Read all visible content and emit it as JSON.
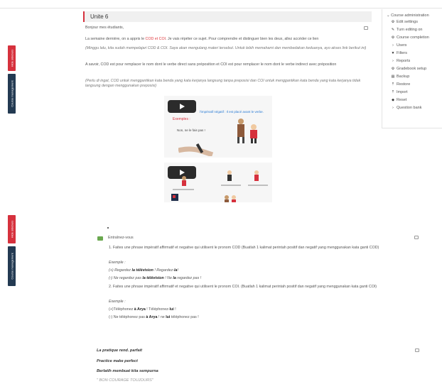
{
  "sidetabs": {
    "hide_sidebars": "Hide sidebars",
    "course_management": "Course management"
  },
  "section": {
    "title": "Unite 6",
    "greeting": "Bonjour mes étudiants,",
    "intro_a": "La semaine dernière, on a appris le ",
    "intro_cod": "COD et COI",
    "intro_b": ". Je vais répéter ce sujet. Pour comprendre et distinguer bien les deux, allez accéder ce lien",
    "intro_id": "(Minggu lalu, kita sudah mempelajari COD & COI. Saya akan mengulang materi tersebut. Untuk lebih memahami dan membedakan keduanya, ayo akses link berikut ini)",
    "def_fr": "A savoir, COD est pour remplacer le nom dont le verbe direct sans préposition et COI est pour remplacer le nom dont le verbe indirect avec préposition",
    "def_id": "(Perlu di ingat, COD untuk menggantikan kata benda yang kata kerjanya langsung tanpa preposisi dan COI untuk menggantikan kata benda yang kata kerjanya tidak langsung dengan menggunakan preposisi)"
  },
  "video1": {
    "caption": "l'impératif négatif : Il est placé avant le verbe.",
    "label": "Exemples :",
    "sample": "Non, ne le fais pas !"
  },
  "admin": {
    "title": "Course administration",
    "items": [
      {
        "icon": "gear-icon",
        "glyph": "⚙",
        "label": "Edit settings"
      },
      {
        "icon": "pencil-icon",
        "glyph": "✎",
        "label": "Turn editing on"
      },
      {
        "icon": "gear-icon",
        "glyph": "⚙",
        "label": "Course completion"
      },
      {
        "icon": "chevron-right-icon",
        "glyph": "›",
        "label": "Users"
      },
      {
        "icon": "filter-icon",
        "glyph": "▼",
        "label": "Filters"
      },
      {
        "icon": "chevron-right-icon",
        "glyph": "›",
        "label": "Reports"
      },
      {
        "icon": "gear-icon",
        "glyph": "⚙",
        "label": "Gradebook setup"
      },
      {
        "icon": "backup-icon",
        "glyph": "▤",
        "label": "Backup"
      },
      {
        "icon": "restore-icon",
        "glyph": "⤒",
        "label": "Restore"
      },
      {
        "icon": "import-icon",
        "glyph": "⤒",
        "label": "Import"
      },
      {
        "icon": "reset-icon",
        "glyph": "◆",
        "label": "Reset"
      },
      {
        "icon": "chevron-right-icon",
        "glyph": "›",
        "label": "Question bank"
      }
    ]
  },
  "quiz": {
    "title": "Entraînez-vous",
    "q1": "1. Faites une phrase impératif affirmatif et negative qui utilisent le pronom COD (Buatlah 1 kalimat perintah positif dan negatif yang menggunakan kata ganti COD)",
    "example": "Exemple :",
    "q1_pos_a": "(+) Regardez ",
    "q1_pos_b": "la télévision",
    "q1_pos_c": " ! Regardez-",
    "q1_pos_d": "la",
    "q1_pos_e": "!",
    "q1_neg_a": "(-) Ne regardez pas ",
    "q1_neg_b": "la télévision",
    "q1_neg_c": " ! Ne ",
    "q1_neg_d": "la",
    "q1_neg_e": " regardez pas !",
    "q2": "2. Faites une phrase impératif affirmatif et negative qui utilisent le pronom COI. (Buatlah 1 kalimat perintah positif dan negatif yang menggunakan kata ganti COI)",
    "q2_pos_a": "(+)Téléphonez ",
    "q2_pos_b": "à Arya",
    "q2_pos_c": " ! Téléphonez-",
    "q2_pos_d": "lui",
    "q2_pos_e": " !",
    "q2_neg_a": "(-) Ne téléphonez pas ",
    "q2_neg_b": "à Arya",
    "q2_neg_c": " ! ne ",
    "q2_neg_d": "lui",
    "q2_neg_e": " téléphonez pas !"
  },
  "footer": {
    "line1": "La pratique rend. parfait",
    "line2": "Practice make perfect",
    "line3": "Berlatih membuat kita sempurna",
    "line4": "\" BON COURAGE TOUJOURS\""
  }
}
